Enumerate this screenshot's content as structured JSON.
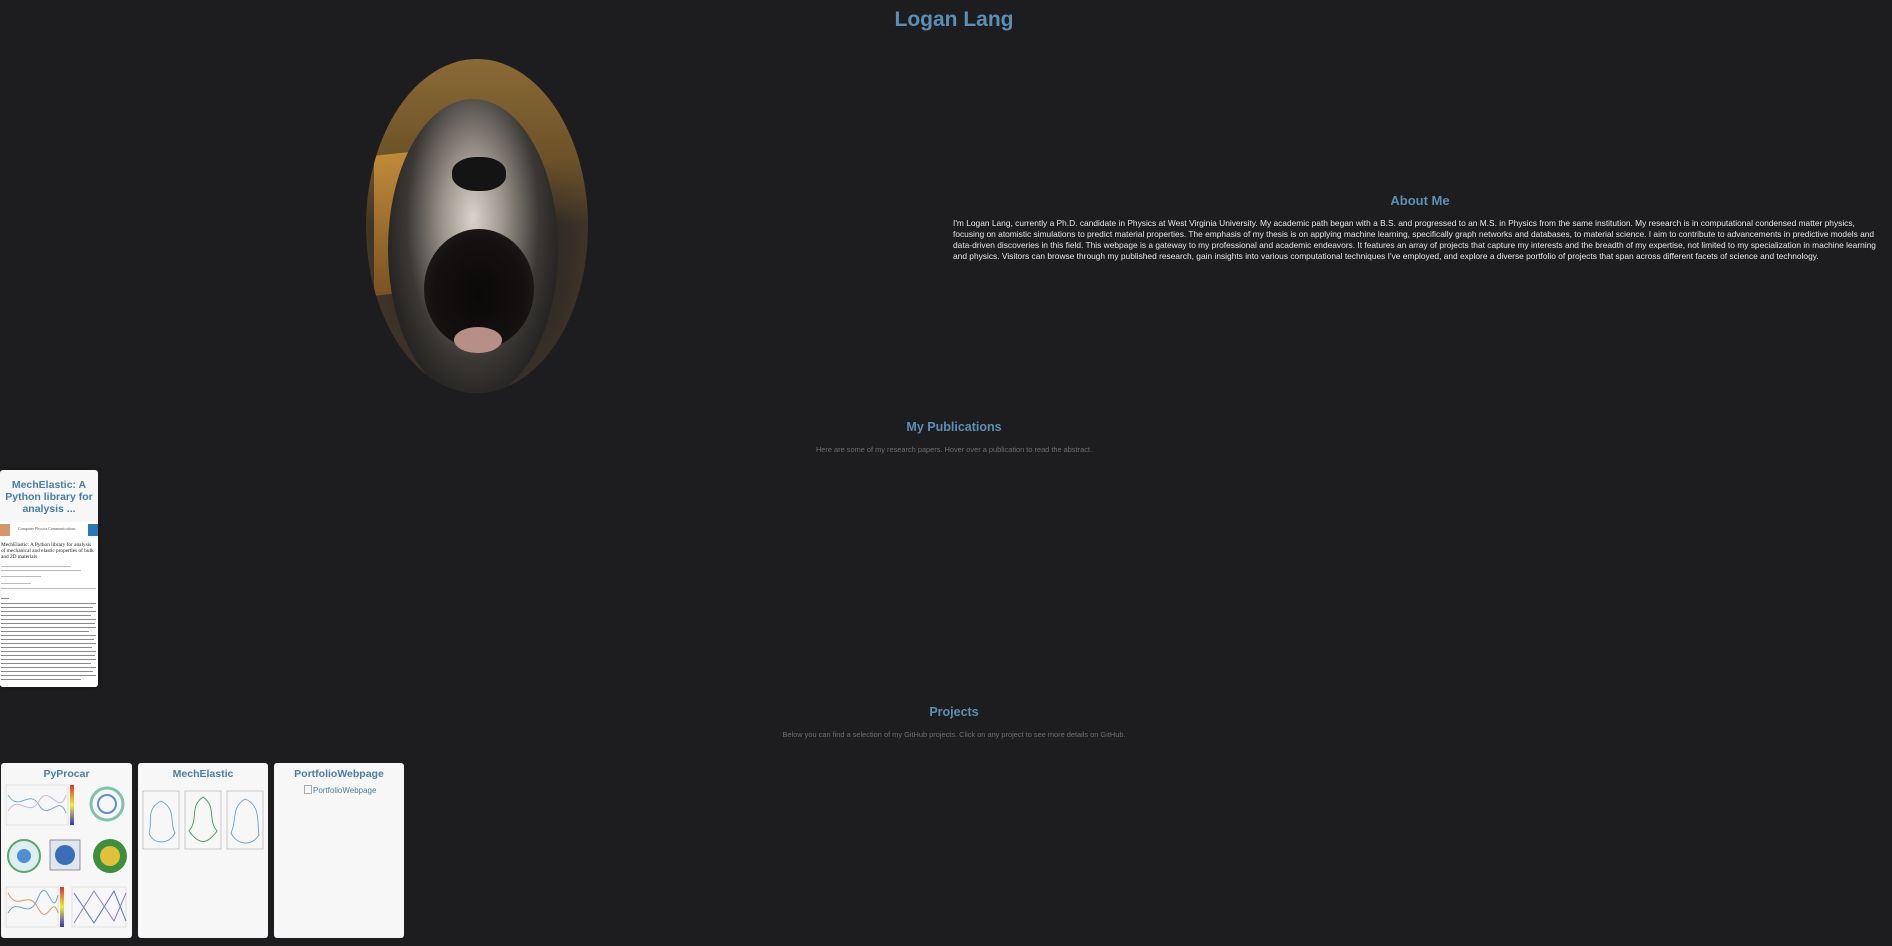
{
  "header": {
    "title": "Logan Lang"
  },
  "about": {
    "heading": "About Me",
    "text": "I'm Logan Lang, currently a Ph.D. candidate in Physics at West Virginia University. My academic path began with a B.S. and progressed to an M.S. in Physics from the same institution. My research is in computational condensed matter physics, focusing on atomistic simulations to predict material properties. The emphasis of my thesis is on applying machine learning, specifically graph networks and databases, to material science. I aim to contribute to advancements in predictive models and data-driven discoveries in this field. This webpage is a gateway to my professional and academic endeavors. It features an array of projects that capture my interests and the breadth of my expertise, not limited to my specialization in machine learning and physics. Visitors can browse through my published research, gain insights into various computational techniques I've employed, and explore a diverse portfolio of projects that span across different facets of science and technology."
  },
  "publications": {
    "heading": "My Publications",
    "subtitle": "Here are some of my research papers. Hover over a publication to read the abstract.",
    "items": [
      {
        "title": "MechElastic: A Python library for analysis ...",
        "journal": "Computer Physics Communications",
        "paper_title": "MechElastic: A Python library for analysis of mechanical and elastic properties of bulk and 2D materials"
      }
    ]
  },
  "projects": {
    "heading": "Projects",
    "subtitle": "Below you can find a selection of my GitHub projects. Click on any project to see more details on GitHub.",
    "items": [
      {
        "title": "PyProcar",
        "image_alt": ""
      },
      {
        "title": "MechElastic",
        "image_alt": ""
      },
      {
        "title": "PortfolioWebpage",
        "image_alt": "PortfolioWebpage"
      }
    ]
  },
  "colors": {
    "background": "#1d1d1f",
    "accent": "#5b8fb5",
    "card": "#f7f7f7"
  }
}
